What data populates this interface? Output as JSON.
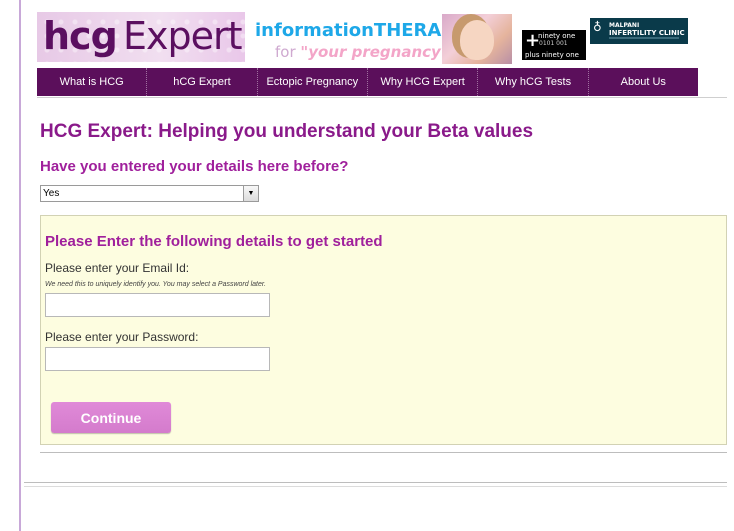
{
  "header": {
    "logo_part1": "hcg",
    "logo_part2": "Expert",
    "tagline_top": "informationTHERAPY",
    "tagline_for": "for ",
    "tagline_emphasis": "\"your pregnancy\"",
    "badge_ninety_line1": "ninety one",
    "badge_ninety_line2": "0101 001",
    "badge_ninety_line3": "plus ninety one",
    "badge_malpani_line1": "MALPANI",
    "badge_malpani_line2": "INFERTILITY CLINIC"
  },
  "nav": {
    "items": [
      "What is HCG",
      "hCG Expert",
      "Ectopic Pregnancy",
      "Why HCG Expert",
      "Why hCG Tests",
      "About Us"
    ]
  },
  "main": {
    "title": "HCG Expert: Helping you understand your Beta values",
    "subtitle": "Have you entered your details here before?",
    "select_value": "Yes"
  },
  "form": {
    "title": "Please Enter the following details to get started",
    "email_label": "Please enter your Email Id:",
    "email_hint": "We need this to uniquely identify you. You may select a Password later.",
    "email_value": "",
    "password_label": "Please enter your Password:",
    "password_value": "",
    "continue_label": "Continue"
  },
  "colors": {
    "nav_bg": "#5b0f5b",
    "heading": "#8a1a8a",
    "accent": "#a0209c",
    "panel_bg": "#fdfde0",
    "button": "#d47bcc",
    "info_blue": "#1ea8e8"
  }
}
